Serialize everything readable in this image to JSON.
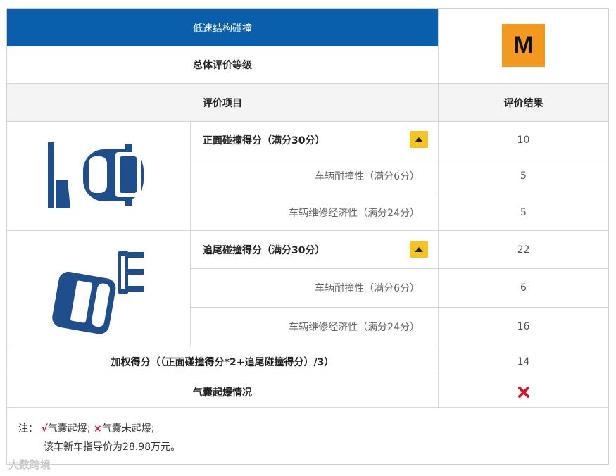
{
  "header": {
    "title": "低速结构碰撞",
    "overall_label": "总体评价等级",
    "grade": "M"
  },
  "columns": {
    "item": "评价项目",
    "result": "评价结果"
  },
  "front": {
    "label": "正面碰撞得分（满分30分）",
    "score": "10",
    "rows": [
      {
        "label": "车辆耐撞性（满分6分）",
        "value": "5"
      },
      {
        "label": "车辆维修经济性（满分24分）",
        "value": "5"
      }
    ]
  },
  "rear": {
    "label": "追尾碰撞得分（满分30分）",
    "score": "22",
    "rows": [
      {
        "label": "车辆耐撞性（满分6分）",
        "value": "6"
      },
      {
        "label": "车辆维修经济性（满分24分）",
        "value": "16"
      }
    ]
  },
  "weighted": {
    "label": "加权得分（（正面碰撞得分*2+追尾碰撞得分）/3）",
    "value": "14"
  },
  "airbag": {
    "label": "气囊起爆情况",
    "value_icon": "red-cross-icon"
  },
  "note": {
    "prefix": "注：",
    "check_symbol": "√",
    "deployed": "气囊起爆;",
    "cross_symbol": "×",
    "not_deployed": "气囊未起爆;",
    "price": "该车新车指导价为28.98万元。"
  },
  "watermark": "大数跨境",
  "colors": {
    "header_blue": "#0a5fad",
    "grade_orange": "#f39a1e",
    "arrow_yellow": "#f5c422",
    "car_blue": "#1f4e8c",
    "cross_red": "#d2172a"
  }
}
